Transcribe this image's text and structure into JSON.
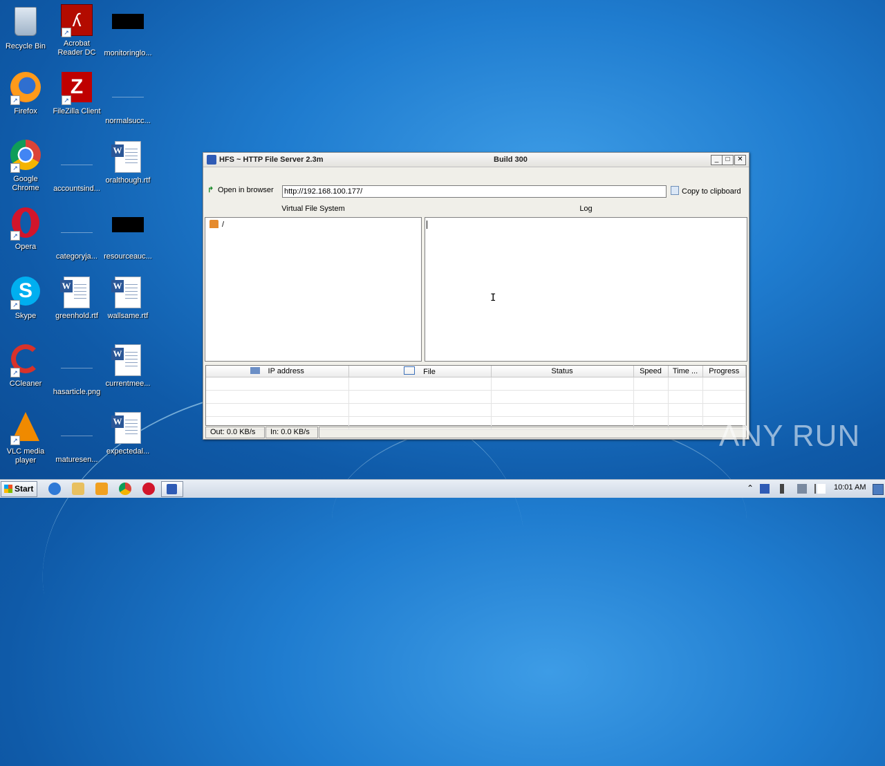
{
  "desktop": {
    "icons": [
      {
        "label": "Recycle Bin",
        "icon": "recycle-bin-icon"
      },
      {
        "label": "Acrobat Reader DC",
        "icon": "acrobat-icon"
      },
      {
        "label": "monitoringlo...",
        "icon": "black-file-icon"
      },
      {
        "label": "Firefox",
        "icon": "firefox-icon"
      },
      {
        "label": "FileZilla Client",
        "icon": "filezilla-icon"
      },
      {
        "label": "normalsucc...",
        "icon": "blank-file-icon"
      },
      {
        "label": "Google Chrome",
        "icon": "chrome-icon"
      },
      {
        "label": "accountsind...",
        "icon": "blank-file-icon"
      },
      {
        "label": "oralthough.rtf",
        "icon": "word-doc-icon"
      },
      {
        "label": "Opera",
        "icon": "opera-icon"
      },
      {
        "label": "categoryja...",
        "icon": "blank-file-icon"
      },
      {
        "label": "resourceauc...",
        "icon": "black-file-icon"
      },
      {
        "label": "Skype",
        "icon": "skype-icon"
      },
      {
        "label": "greenhold.rtf",
        "icon": "word-doc-icon"
      },
      {
        "label": "wallsame.rtf",
        "icon": "word-doc-icon"
      },
      {
        "label": "CCleaner",
        "icon": "ccleaner-icon"
      },
      {
        "label": "hasarticle.png",
        "icon": "blank-file-icon"
      },
      {
        "label": "currentmee...",
        "icon": "word-doc-icon"
      },
      {
        "label": "VLC media player",
        "icon": "vlc-icon"
      },
      {
        "label": "maturesen...",
        "icon": "blank-file-icon"
      },
      {
        "label": "expectedal...",
        "icon": "word-doc-icon"
      }
    ]
  },
  "window": {
    "title": "HFS ~ HTTP File Server 2.3m",
    "build": "Build 300",
    "open_browser_label": "Open in browser",
    "url": "http://192.168.100.177/",
    "copy_label": "Copy to clipboard",
    "vfs_header": "Virtual File System",
    "vfs_root": "/",
    "log_header": "Log",
    "columns": [
      "IP address",
      "File",
      "Status",
      "Speed",
      "Time ...",
      "Progress"
    ],
    "status_out": "Out: 0.0 KB/s",
    "status_in": "In: 0.0 KB/s"
  },
  "taskbar": {
    "start_label": "Start",
    "clock": "10:01 AM"
  },
  "watermark": "ANY RUN"
}
